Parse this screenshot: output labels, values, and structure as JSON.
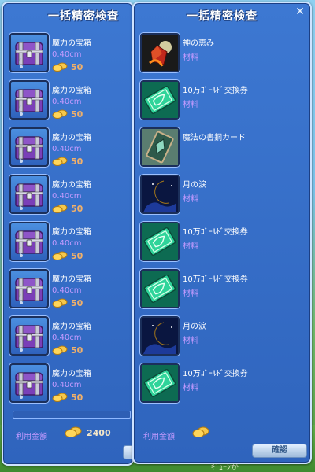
{
  "left": {
    "title": "一括精密検査",
    "items": [
      {
        "name": "魔力の宝箱",
        "size": "0.40cm",
        "price": "50"
      },
      {
        "name": "魔力の宝箱",
        "size": "0.40cm",
        "price": "50"
      },
      {
        "name": "魔力の宝箱",
        "size": "0.40cm",
        "price": "50"
      },
      {
        "name": "魔力の宝箱",
        "size": "0.40cm",
        "price": "50"
      },
      {
        "name": "魔力の宝箱",
        "size": "0.40cm",
        "price": "50"
      },
      {
        "name": "魔力の宝箱",
        "size": "0.40cm",
        "price": "50"
      },
      {
        "name": "魔力の宝箱",
        "size": "0.40cm",
        "price": "50"
      },
      {
        "name": "魔力の宝箱",
        "size": "0.40cm",
        "price": "50"
      }
    ],
    "total_label": "利用金額",
    "total_value": "2400"
  },
  "right": {
    "title": "一括精密検査",
    "close_glyph": "✕",
    "items": [
      {
        "name": "神の恵み",
        "category": "材料",
        "icon": "gem-fire-icon"
      },
      {
        "name": "10万ｺﾞｰﾙﾄﾞ交換券",
        "category": "材料",
        "icon": "ticket-icon"
      },
      {
        "name": "魔法の書銅カード",
        "category": "",
        "icon": "card-icon"
      },
      {
        "name": "月の涙",
        "category": "材料",
        "icon": "moon-icon"
      },
      {
        "name": "10万ｺﾞｰﾙﾄﾞ交換券",
        "category": "材料",
        "icon": "ticket-icon"
      },
      {
        "name": "10万ｺﾞｰﾙﾄﾞ交換券",
        "category": "材料",
        "icon": "ticket-icon"
      },
      {
        "name": "月の涙",
        "category": "材料",
        "icon": "moon-icon"
      },
      {
        "name": "10万ｺﾞｰﾙﾄﾞ交換券",
        "category": "材料",
        "icon": "ticket-icon"
      }
    ],
    "total_label": "利用金額",
    "ok_label": "確認"
  },
  "background_text": "ｷﾞｭｰﾝが"
}
